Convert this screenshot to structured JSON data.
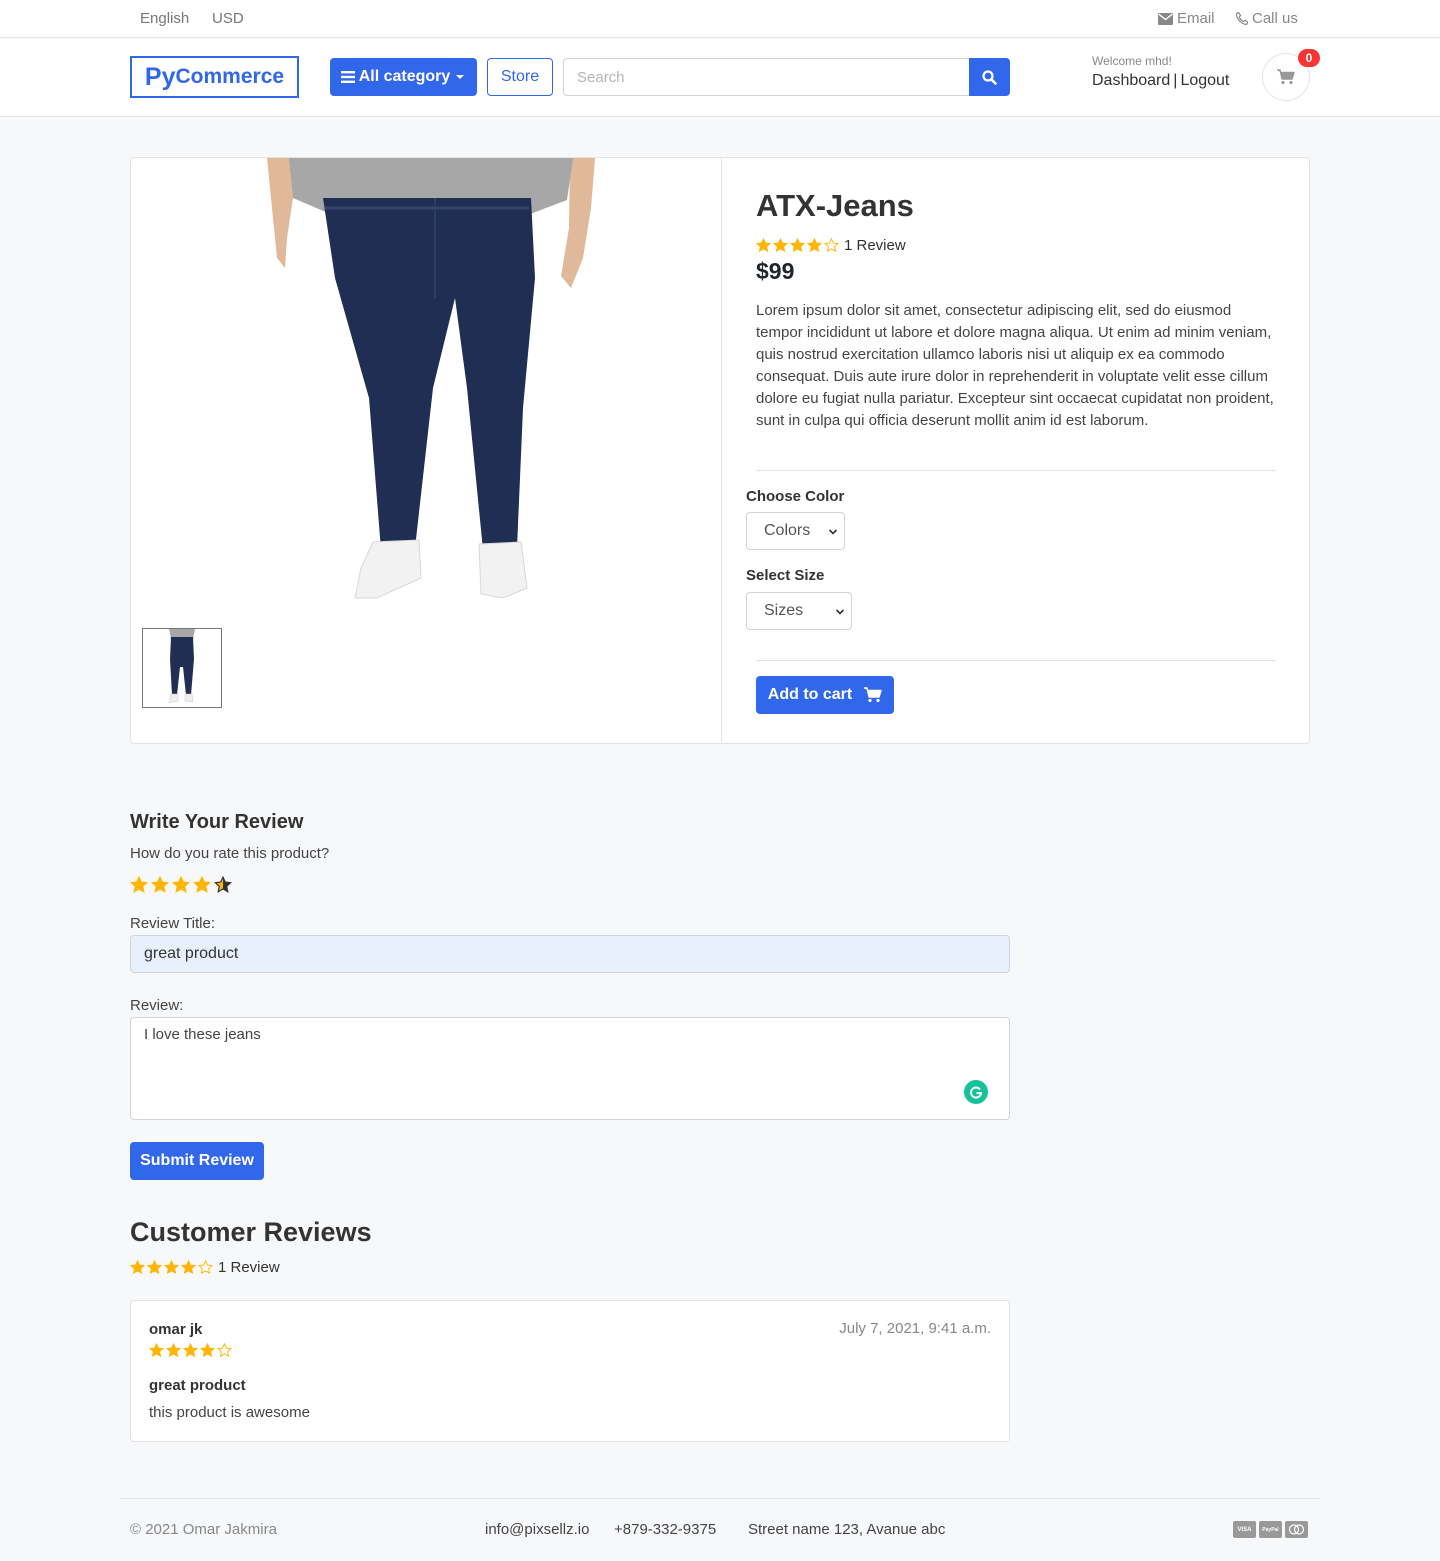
{
  "topbar": {
    "language": "English",
    "currency": "USD",
    "email_label": "Email",
    "call_label": "Call us"
  },
  "header": {
    "logo_py": "Py",
    "logo_commerce": "Commerce",
    "category_button": "All category",
    "store_button": "Store",
    "search_placeholder": "Search",
    "welcome": "Welcome mhd!",
    "dashboard_link": "Dashboard",
    "separator": "|",
    "logout_link": "Logout",
    "cart_count": "0"
  },
  "product": {
    "title": "ATX-Jeans",
    "rating": 4,
    "review_count_label": "1 Review",
    "price": "$99",
    "description": "Lorem ipsum dolor sit amet, consectetur adipiscing elit, sed do eiusmod tempor incididunt ut labore et dolore magna aliqua. Ut enim ad minim veniam, quis nostrud exercitation ullamco laboris nisi ut aliquip ex ea commodo consequat. Duis aute irure dolor in reprehenderit in voluptate velit esse cillum dolore eu fugiat nulla pariatur. Excepteur sint occaecat cupidatat non proident, sunt in culpa qui officia deserunt mollit anim id est laborum.",
    "choose_color_label": "Choose Color",
    "color_select": "Colors",
    "select_size_label": "Select Size",
    "size_select": "Sizes",
    "add_to_cart": "Add to cart"
  },
  "review_form": {
    "heading": "Write Your Review",
    "question": "How do you rate this product?",
    "selected_rating": 4.5,
    "title_label": "Review Title:",
    "title_value": "great product",
    "review_label": "Review:",
    "review_value": "I love these jeans",
    "submit": "Submit Review"
  },
  "customer_reviews": {
    "heading": "Customer Reviews",
    "average_rating": 4,
    "count_label": "1 Review",
    "items": [
      {
        "user": "omar jk",
        "date": "July 7, 2021, 9:41 a.m.",
        "rating": 4,
        "title": "great product",
        "body": "this product is awesome"
      }
    ]
  },
  "footer": {
    "copyright": "© 2021 Omar Jakmira",
    "email": "info@pixsellz.io",
    "phone": "+879-332-9375",
    "address": "Street name 123, Avanue abc",
    "payments": [
      "VISA",
      "PayPal",
      "MC"
    ]
  },
  "colors": {
    "primary": "#3167eb",
    "star": "#ffb503",
    "badge": "#fa3434",
    "grammarly": "#15c39a"
  }
}
